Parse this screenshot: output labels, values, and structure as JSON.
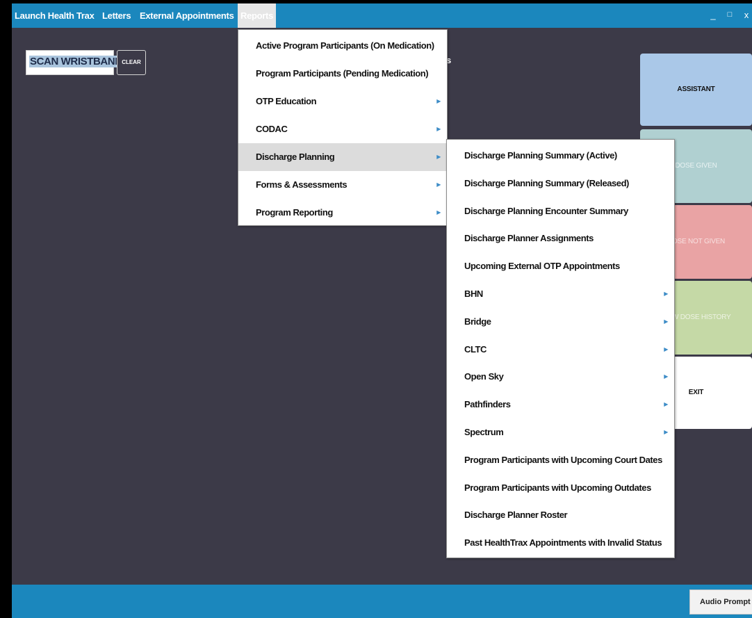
{
  "menubar": {
    "items": [
      {
        "label": "Launch Health Trax"
      },
      {
        "label": "Letters"
      },
      {
        "label": "External Appointments"
      },
      {
        "label": "Reports"
      }
    ],
    "minimize_icon": "_",
    "maximize_icon": "□",
    "close_icon": "x"
  },
  "scan": {
    "input_value": "SCAN WRISTBAND",
    "clear_label": "CLEAR"
  },
  "actions": {
    "assistant": "ASSISTANT",
    "dose_given": "DOSE GIVEN",
    "dose_not_given": "DOSE NOT GIVEN",
    "view_dose_history": "VIEW DOSE HISTORY",
    "exit": "EXIT",
    "colors": {
      "assistant": "#aac8e8",
      "dose_given": "#b0d0d1",
      "dose_not_given": "#e9a3a4",
      "view_dose_history": "#c5d9a6",
      "exit": "#ffffff"
    }
  },
  "reports_menu": {
    "items": [
      {
        "label": "Active Program Participants (On Medication)",
        "submenu": false
      },
      {
        "label": "Program Participants (Pending Medication)",
        "submenu": false
      },
      {
        "label": "OTP Education",
        "submenu": true
      },
      {
        "label": "CODAC",
        "submenu": true
      },
      {
        "label": "Discharge Planning",
        "submenu": true
      },
      {
        "label": "Forms & Assessments",
        "submenu": true
      },
      {
        "label": "Program Reporting",
        "submenu": true
      }
    ],
    "selected": "Discharge Planning"
  },
  "discharge_menu": {
    "items": [
      {
        "label": "Discharge Planning Summary (Active)",
        "submenu": false
      },
      {
        "label": "Discharge Planning Summary (Released)",
        "submenu": false
      },
      {
        "label": "Discharge Planning Encounter Summary",
        "submenu": false
      },
      {
        "label": "Discharge Planner Assignments",
        "submenu": false
      },
      {
        "label": "Upcoming External OTP Appointments",
        "submenu": false
      },
      {
        "label": "BHN",
        "submenu": true
      },
      {
        "label": "Bridge",
        "submenu": true
      },
      {
        "label": "CLTC",
        "submenu": true
      },
      {
        "label": "Open Sky",
        "submenu": true
      },
      {
        "label": "Pathfinders",
        "submenu": true
      },
      {
        "label": "Spectrum",
        "submenu": true
      },
      {
        "label": "Program Participants with Upcoming Court Dates",
        "submenu": false
      },
      {
        "label": "Program Participants with Upcoming Outdates",
        "submenu": false
      },
      {
        "label": "Discharge Planner Roster",
        "submenu": false
      },
      {
        "label": "Past HealthTrax Appointments with Invalid Status",
        "submenu": false
      }
    ]
  },
  "submenu_arrow_icon": "▶",
  "background_peek_text": "s",
  "bottombar": {
    "audio_button": "Audio Prompt On"
  },
  "colors": {
    "menubar": "#1b87bd",
    "background": "#3c3a48",
    "submenu_arrow": "#3d8cc7"
  }
}
